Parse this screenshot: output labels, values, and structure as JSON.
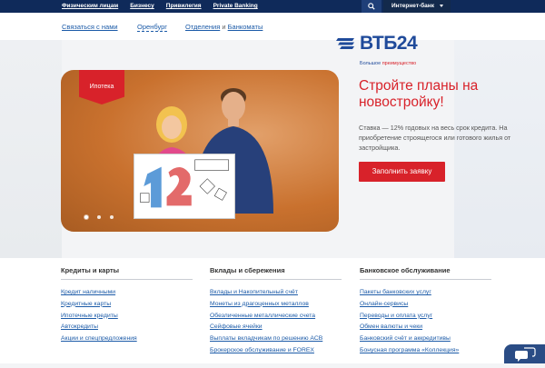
{
  "topbar": {
    "nav": [
      "Физическим лицам",
      "Бизнесу",
      "Привилегия",
      "Private Banking"
    ],
    "internet_bank": "Интернет-банк"
  },
  "subbar": {
    "contact": "Связаться с нами",
    "city": "Оренбург",
    "branches_1": "Отделения",
    "branches_and": " и ",
    "branches_2": "Банкоматы"
  },
  "logo": {
    "name": "ВТБ24",
    "slogan_1": "Большое ",
    "slogan_2": "преимущество"
  },
  "banner": {
    "tag": "Ипотека",
    "slide_count": 3,
    "active_slide": 1
  },
  "offer": {
    "title": "Стройте планы на новостройку!",
    "text": "Ставка — 12% годовых на весь срок кредита. На приобретение строящегося или готового жилья от застройщика.",
    "button": "Заполнить заявку"
  },
  "columns": [
    {
      "heading": "Кредиты и карты",
      "items": [
        "Кредит наличными",
        "Кредитные карты",
        "Ипотечные кредиты",
        "Автокредиты",
        "Акции и спецпредложения"
      ]
    },
    {
      "heading": "Вклады и сбережения",
      "items": [
        "Вклады и Накопительный счёт",
        "Монеты из драгоценных металлов",
        "Обезличенные металлические счета",
        "Сейфовые ячейки",
        "Выплаты вкладчикам по решению АСВ",
        "Брокерское обслуживание и FOREX"
      ]
    },
    {
      "heading": "Банковское обслуживание",
      "items": [
        "Пакеты банковских услуг",
        "Онлайн-сервисы",
        "Переводы и оплата услуг",
        "Обмен валюты и чеки",
        "Банковский счёт и аккредитивы",
        "Бонусная программа «Коллекция»"
      ]
    }
  ],
  "colors": {
    "brand_blue": "#1f4a9a",
    "brand_red": "#d8222a",
    "topbar": "#0f2a5a"
  }
}
